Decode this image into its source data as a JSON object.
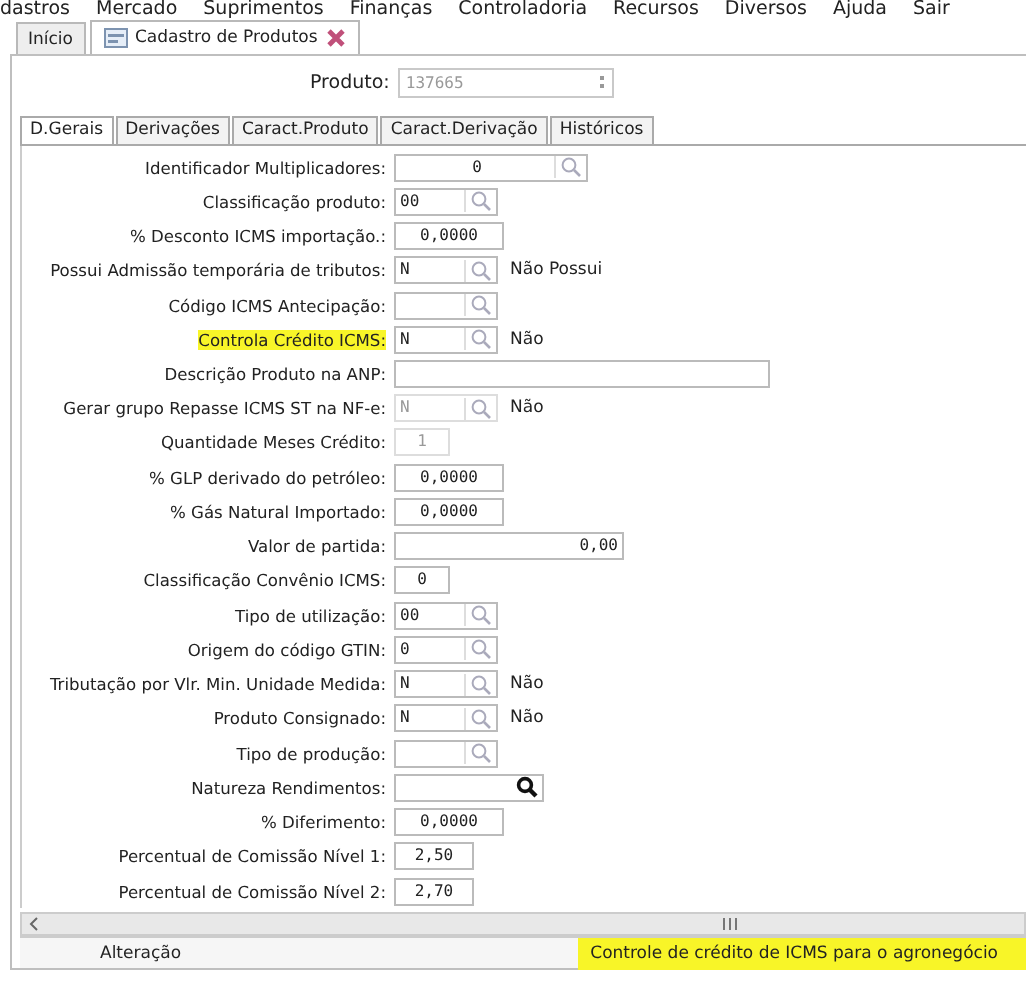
{
  "menu": [
    "dastros",
    "Mercado",
    "Suprimentos",
    "Finanças",
    "Controladoria",
    "Recursos",
    "Diversos",
    "Ajuda",
    "Sair"
  ],
  "window_tabs": [
    {
      "label": "Início",
      "selected": false,
      "closable": false
    },
    {
      "label": "Cadastro de Produtos",
      "selected": true,
      "closable": true
    }
  ],
  "product": {
    "label": "Produto:",
    "value": "137665",
    "disabled": true
  },
  "tabs": [
    {
      "label": "D.Gerais",
      "selected": true
    },
    {
      "label": "Derivações",
      "selected": false
    },
    {
      "label": "Caract.Produto",
      "selected": false
    },
    {
      "label": "Caract.Derivação",
      "selected": false
    },
    {
      "label": "Históricos",
      "selected": false
    }
  ],
  "fields": [
    {
      "label": "Identificador Multiplicadores:",
      "kind": "widelookup",
      "value": "0",
      "disabled": false,
      "highlighted": false
    },
    {
      "label": "Classificação produto:",
      "kind": "lookup",
      "value": "00",
      "disabled": false,
      "highlighted": false
    },
    {
      "label": "% Desconto ICMS importação.:",
      "kind": "number",
      "value": "0,0000",
      "disabled": false,
      "highlighted": false
    },
    {
      "label": "Possui Admissão temporária de tributos:",
      "kind": "lookup",
      "value": "N",
      "suffix": "Não Possui",
      "disabled": false,
      "highlighted": false
    },
    {
      "label": "Código ICMS Antecipação:",
      "kind": "lookup",
      "disabled": false,
      "highlighted": false
    },
    {
      "label": "Controla Crédito ICMS:",
      "kind": "lookup",
      "value": "N",
      "suffix": "Não",
      "disabled": false,
      "highlighted": true
    },
    {
      "label": "Descrição Produto na ANP:",
      "kind": "text",
      "disabled": false,
      "highlighted": false
    },
    {
      "label": "Gerar grupo Repasse ICMS ST na NF-e:",
      "kind": "lookup",
      "value": "N",
      "suffix": "Não",
      "disabled": true,
      "highlighted": false
    },
    {
      "label": "Quantidade Meses Crédito:",
      "kind": "tiny",
      "value": "1",
      "disabled": true,
      "highlighted": false
    },
    {
      "label": "% GLP derivado do petróleo:",
      "kind": "number",
      "value": "0,0000",
      "disabled": false,
      "highlighted": false
    },
    {
      "label": "% Gás Natural Importado:",
      "kind": "number",
      "value": "0,0000",
      "disabled": false,
      "highlighted": false
    },
    {
      "label": "Valor de partida:",
      "kind": "amount",
      "value": "0,00",
      "disabled": false,
      "highlighted": false
    },
    {
      "label": "Classificação Convênio ICMS:",
      "kind": "tiny",
      "value": "0",
      "disabled": false,
      "highlighted": false
    },
    {
      "label": "Tipo de utilização:",
      "kind": "lookup",
      "value": "00",
      "disabled": false,
      "highlighted": false
    },
    {
      "label": "Origem do código GTIN:",
      "kind": "lookup",
      "value": "0",
      "disabled": false,
      "highlighted": false
    },
    {
      "label": "Tributação por Vlr. Min. Unidade Medida:",
      "kind": "lookup",
      "value": "N",
      "suffix": "Não",
      "disabled": false,
      "highlighted": false
    },
    {
      "label": "Produto Consignado:",
      "kind": "lookup",
      "value": "N",
      "suffix": "Não",
      "disabled": false,
      "highlighted": false
    },
    {
      "label": "Tipo de produção:",
      "kind": "lookup",
      "disabled": false,
      "highlighted": false
    },
    {
      "label": "Natureza Rendimentos:",
      "kind": "search",
      "disabled": false,
      "highlighted": false
    },
    {
      "label": "% Diferimento:",
      "kind": "number",
      "value": "0,0000",
      "disabled": false,
      "highlighted": false
    },
    {
      "label": "Percentual de Comissão Nível 1:",
      "kind": "short",
      "value": "2,50",
      "disabled": false,
      "highlighted": false
    },
    {
      "label": "Percentual de Comissão Nível 2:",
      "kind": "short",
      "value": "2,70",
      "disabled": false,
      "highlighted": false
    }
  ],
  "status_bar": [
    {
      "text": "Alteração",
      "highlighted": false
    },
    {
      "text": "Controle de crédito de ICMS para o agronegócio",
      "highlighted": true
    }
  ]
}
